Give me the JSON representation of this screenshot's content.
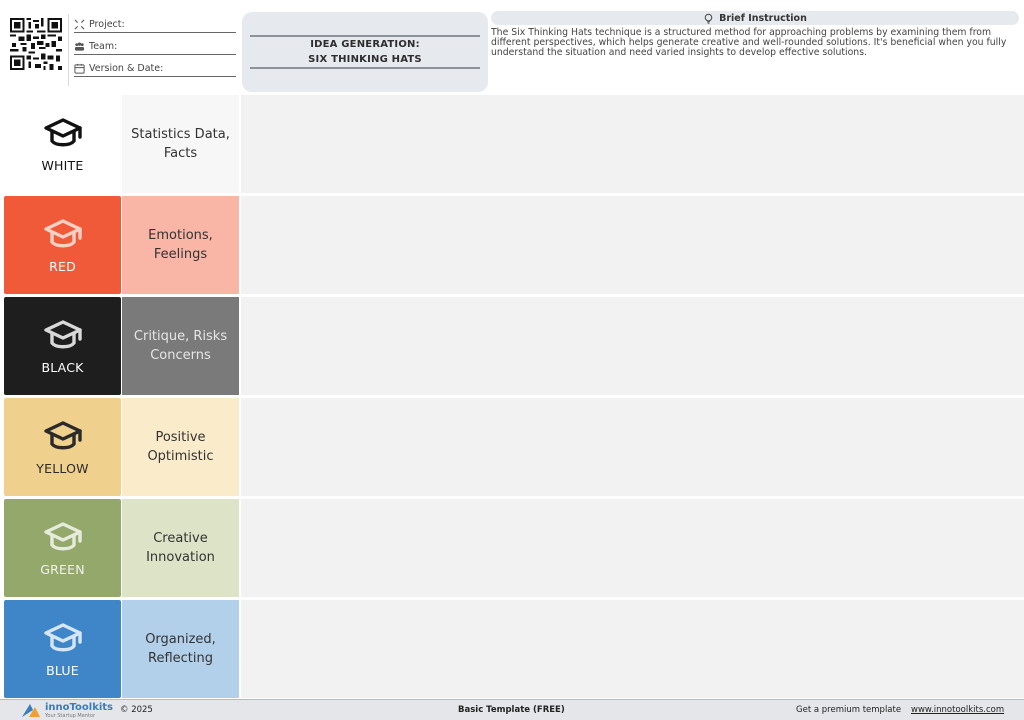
{
  "header": {
    "project_label": "Project:",
    "team_label": "Team:",
    "version_label": "Version & Date:",
    "title_line1": "IDEA GENERATION:",
    "title_line2": "SIX THINKING HATS",
    "instruction_heading": "Brief Instruction",
    "instruction_text": "The Six Thinking Hats technique is a structured method for approaching problems by examining them from different perspectives, which helps generate creative and well-rounded solutions. It's beneficial when you fully understand the situation and need varied insights to develop effective solutions."
  },
  "hats": [
    {
      "name": "WHITE",
      "description": "Statistics Data, Facts",
      "hat_color": "#ffffff",
      "hat_text_color": "#111111",
      "icon_color": "#111111",
      "desc_bg": "#f7f7f7",
      "desc_text_color": "#333333"
    },
    {
      "name": "RED",
      "description": "Emotions, Feelings",
      "hat_color": "#f05a38",
      "hat_text_color": "#ffffff",
      "icon_color": "#f7d0c6",
      "desc_bg": "#f9b6a6",
      "desc_text_color": "#333333"
    },
    {
      "name": "BLACK",
      "description": "Critique, Risks Concerns",
      "hat_color": "#1e1e1e",
      "hat_text_color": "#ffffff",
      "icon_color": "#d9d9d9",
      "desc_bg": "#7a7a7a",
      "desc_text_color": "#e6e6e6"
    },
    {
      "name": "YELLOW",
      "description": "Positive Optimistic",
      "hat_color": "#efd08c",
      "hat_text_color": "#2a2a2a",
      "icon_color": "#2a2a2a",
      "desc_bg": "#faebca",
      "desc_text_color": "#333333"
    },
    {
      "name": "GREEN",
      "description": "Creative Innovation",
      "hat_color": "#93a86a",
      "hat_text_color": "#f2f2f2",
      "icon_color": "#e6ebdc",
      "desc_bg": "#dce3c6",
      "desc_text_color": "#333333"
    },
    {
      "name": "BLUE",
      "description": "Organized, Reflecting",
      "hat_color": "#3f86c8",
      "hat_text_color": "#ffffff",
      "icon_color": "#d6e6f5",
      "desc_bg": "#b3d0ea",
      "desc_text_color": "#333333"
    }
  ],
  "footer": {
    "brand": "innoToolkits",
    "brand_tagline": "Your Startup Mentor",
    "copyright": "© 2025",
    "template_label": "Basic Template (FREE)",
    "premium_text": "Get a premium template",
    "website": "www.innotoolkits.com"
  }
}
